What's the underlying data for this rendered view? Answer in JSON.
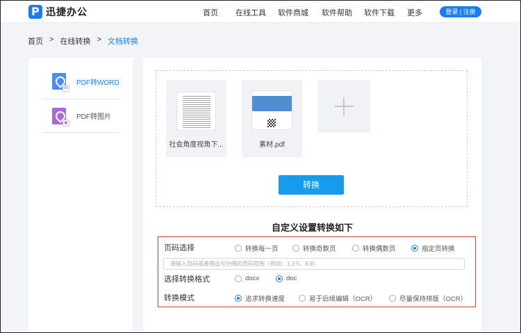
{
  "app": {
    "name": "迅捷办公"
  },
  "nav": {
    "items": [
      "首页",
      "在线工具",
      "软件商城",
      "软件帮助",
      "软件下载",
      "更多"
    ],
    "login_label": "登录 | 注册"
  },
  "breadcrumb": {
    "items": [
      "首页",
      ">",
      "在线转换",
      ">",
      "文档转换"
    ]
  },
  "sidebar": {
    "items": [
      {
        "label": "PDF转WORD",
        "icon": "pdf-to-word-icon",
        "active": true
      },
      {
        "label": "PDF转图片",
        "icon": "pdf-to-image-icon",
        "active": false
      }
    ]
  },
  "files": [
    {
      "name": "社会角度视角下...",
      "thumbnail": "document-page-thumbnail"
    },
    {
      "name": "素材.pdf",
      "thumbnail": "pdf-cover-thumbnail"
    }
  ],
  "convert_button": "转换",
  "settings": {
    "title": "自定义设置转换如下",
    "page_select": {
      "label": "页码选择",
      "options": [
        "转换每一页",
        "转换奇数页",
        "转换偶数页",
        "指定页转换"
      ],
      "selected": 3
    },
    "page_input": {
      "placeholder": "请输入页码或者用逗号分隔的页码范围（例如：1,3-5、8,9）"
    },
    "format": {
      "label": "选择转换格式",
      "options": [
        "docx",
        "doc"
      ],
      "selected": 1
    },
    "mode": {
      "label": "转换模式",
      "options": [
        "追求转换速度",
        "易于后续编辑（OCR）",
        "尽量保持排版（OCR）"
      ],
      "selected": 0
    }
  },
  "colors": {
    "accent": "#1a7cf2",
    "highlight_border": "#e23a3a",
    "button": "#169bef"
  }
}
